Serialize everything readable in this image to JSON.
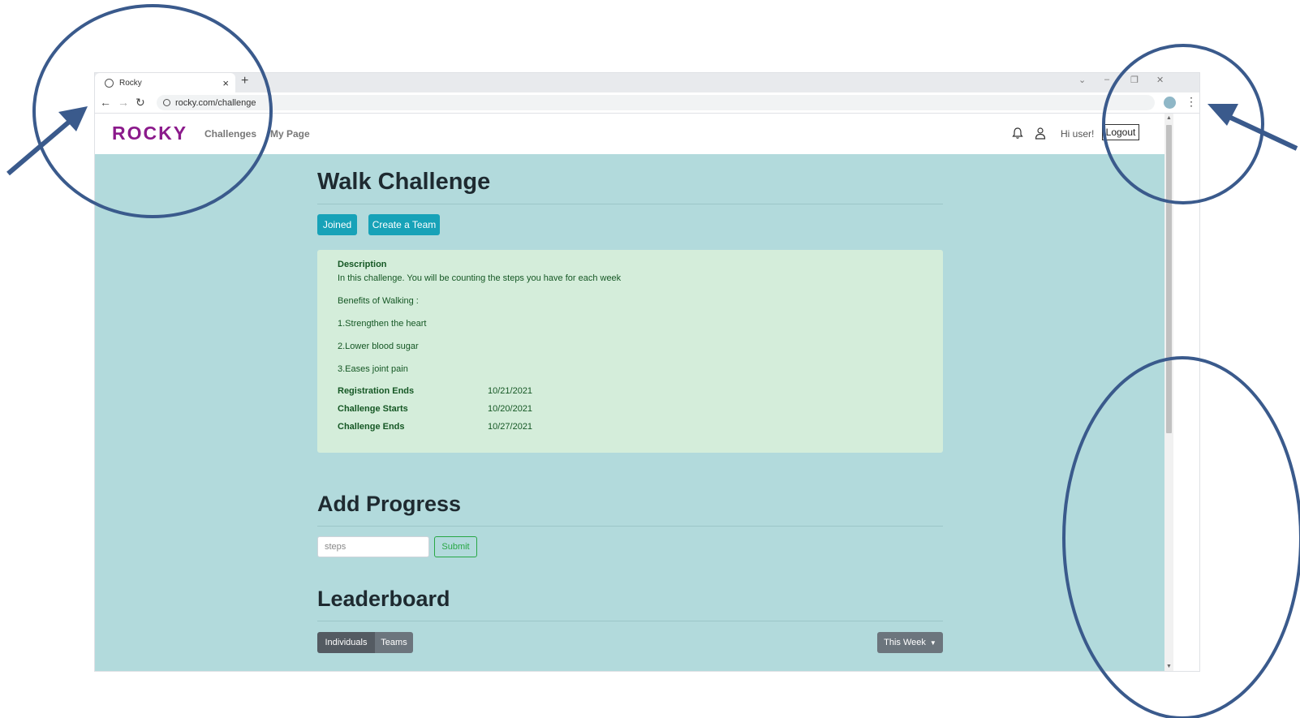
{
  "browser": {
    "tab_title": "Rocky",
    "tab_close": "×",
    "new_tab": "+",
    "url": "rocky.com/challenge"
  },
  "navbar": {
    "brand": "ROCKY",
    "links": [
      "Challenges",
      "My Page"
    ],
    "greeting": "Hi user!",
    "logout": "Logout"
  },
  "challenge": {
    "title": "Walk Challenge",
    "buttons": {
      "joined": "Joined",
      "create_team": "Create a Team"
    },
    "description_heading": "Description",
    "description_text": "In this challenge. You will be counting the steps you have for each week",
    "benefits_heading": "Benefits of Walking :",
    "benefits": [
      "1.Strengthen the heart",
      "2.Lower blood sugar",
      "3.Eases joint pain"
    ],
    "dates": [
      {
        "label": "Registration Ends",
        "value": "10/21/2021"
      },
      {
        "label": "Challenge Starts",
        "value": "10/20/2021"
      },
      {
        "label": "Challenge Ends",
        "value": "10/27/2021"
      }
    ]
  },
  "progress": {
    "title": "Add Progress",
    "placeholder": "steps",
    "submit": "Submit"
  },
  "leaderboard": {
    "title": "Leaderboard",
    "segments": [
      "Individuals",
      "Teams"
    ],
    "period": "This Week"
  },
  "colors": {
    "brand": "#8b1a8b",
    "page_bg": "#b2dadc",
    "primary": "#17a2b8",
    "success_bg": "#d4edda",
    "annotation": "#3a5a8c"
  }
}
